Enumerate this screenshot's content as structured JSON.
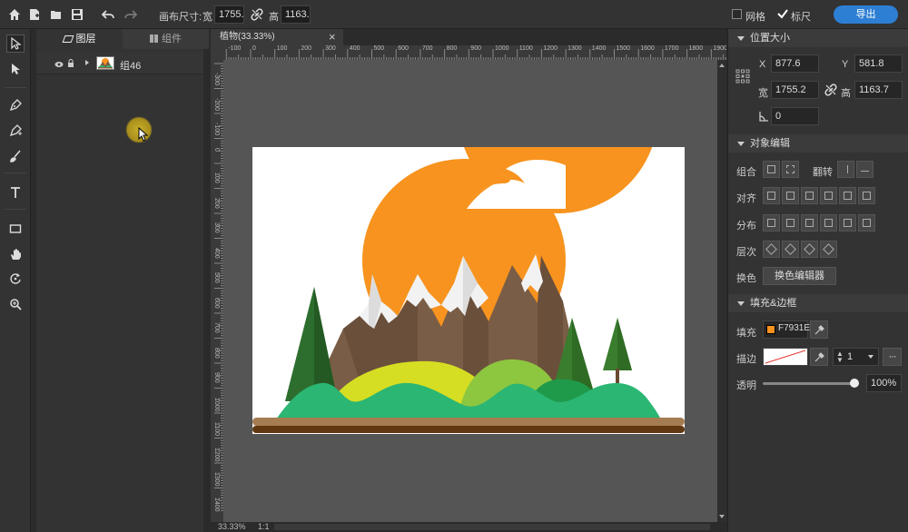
{
  "topbar": {
    "canvas_size_label": "画布尺寸:",
    "width_label": "宽",
    "width_value": "1755.",
    "height_label": "高",
    "height_value": "1163.",
    "grid_label": "网格",
    "ruler_label": "标尺",
    "export_label": "导出"
  },
  "layers": {
    "tab_layers": "图层",
    "tab_components": "组件",
    "item_name": "组46"
  },
  "document": {
    "tab_title": "植物(33.33%)",
    "close": "×",
    "zoom": "33.33%",
    "ratio": "1:1"
  },
  "ruler": {
    "h_ticks": [
      "-100",
      "0",
      "100",
      "200",
      "300",
      "400",
      "500",
      "600",
      "700",
      "800",
      "900",
      "1000",
      "1100",
      "1200",
      "1300",
      "1400",
      "1500",
      "1600",
      "1700",
      "1800",
      "1900",
      "2000"
    ],
    "v_ticks": [
      "-300",
      "-200",
      "-100",
      "0",
      "100",
      "200",
      "300",
      "400",
      "500",
      "600",
      "700",
      "800",
      "900",
      "1000",
      "1100",
      "1200",
      "1300",
      "1400"
    ]
  },
  "props": {
    "section_position": "位置大小",
    "x_label": "X",
    "x_value": "877.6",
    "y_label": "Y",
    "y_value": "581.8",
    "w_label": "宽",
    "w_value": "1755.2",
    "h_label": "高",
    "h_value": "1163.7",
    "angle_value": "0",
    "section_edit": "对象编辑",
    "group_label": "组合",
    "flip_label": "翻转",
    "align_label": "对齐",
    "distribute_label": "分布",
    "layer_label": "层次",
    "recolor_label": "换色",
    "recolor_button": "换色编辑器",
    "section_fill": "填充&边框",
    "fill_label": "填充",
    "fill_value": "F7931E",
    "stroke_label": "描边",
    "stroke_width": "1",
    "opacity_label": "透明",
    "opacity_value": "100%",
    "more": "···"
  },
  "colors": {
    "accent": "#2d7fd4",
    "fill_swatch": "#F7931E"
  },
  "opacity_fraction": 1.0
}
